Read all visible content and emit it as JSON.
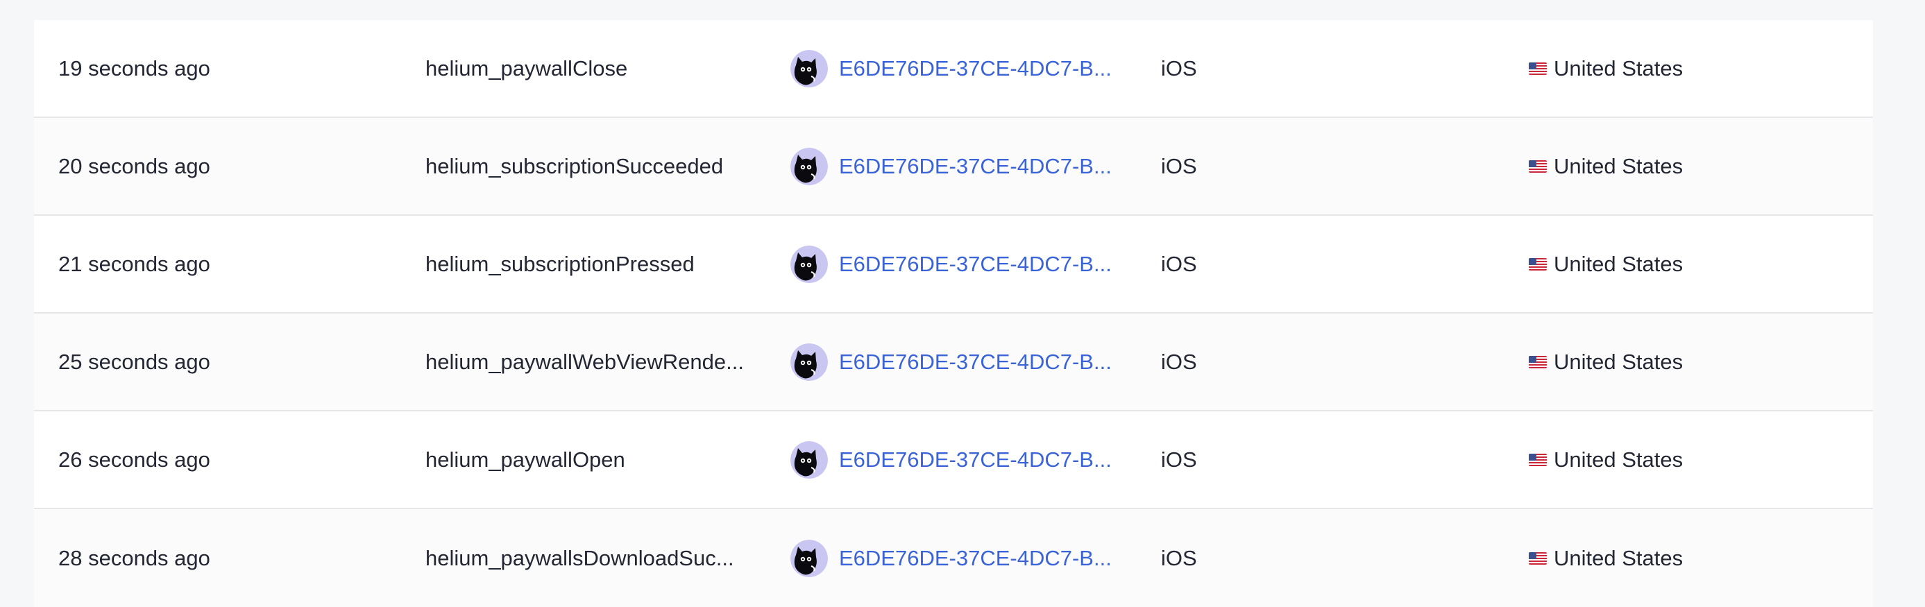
{
  "events": [
    {
      "time": "19 seconds ago",
      "event": "helium_paywallClose",
      "user_id": "E6DE76DE-37CE-4DC7-B...",
      "platform": "iOS",
      "country": "United States",
      "flag_icon": "us-flag-icon"
    },
    {
      "time": "20 seconds ago",
      "event": "helium_subscriptionSucceeded",
      "user_id": "E6DE76DE-37CE-4DC7-B...",
      "platform": "iOS",
      "country": "United States",
      "flag_icon": "us-flag-icon"
    },
    {
      "time": "21 seconds ago",
      "event": "helium_subscriptionPressed",
      "user_id": "E6DE76DE-37CE-4DC7-B...",
      "platform": "iOS",
      "country": "United States",
      "flag_icon": "us-flag-icon"
    },
    {
      "time": "25 seconds ago",
      "event": "helium_paywallWebViewRende...",
      "user_id": "E6DE76DE-37CE-4DC7-B...",
      "platform": "iOS",
      "country": "United States",
      "flag_icon": "us-flag-icon"
    },
    {
      "time": "26 seconds ago",
      "event": "helium_paywallOpen",
      "user_id": "E6DE76DE-37CE-4DC7-B...",
      "platform": "iOS",
      "country": "United States",
      "flag_icon": "us-flag-icon"
    },
    {
      "time": "28 seconds ago",
      "event": "helium_paywallsDownloadSuc...",
      "user_id": "E6DE76DE-37CE-4DC7-B...",
      "platform": "iOS",
      "country": "United States",
      "flag_icon": "us-flag-icon"
    }
  ],
  "colors": {
    "link": "#3a63d8",
    "text": "#232733",
    "avatar_bg": "#c9c6f2",
    "row_border": "#e6e6e9"
  }
}
